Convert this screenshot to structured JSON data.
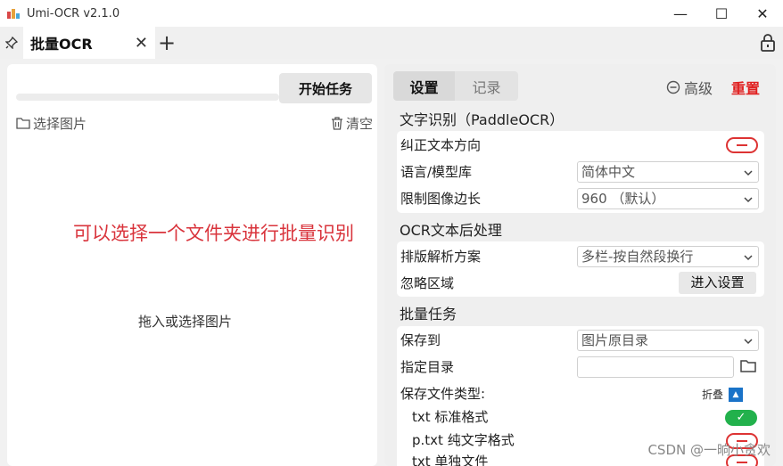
{
  "window": {
    "title": "Umi-OCR v2.1.0",
    "controls": {
      "minimize": "—",
      "maximize": "☐",
      "close": "✕"
    }
  },
  "tabs": {
    "active_tab": "批量OCR",
    "close_glyph": "✕",
    "add_glyph": "+"
  },
  "left_panel": {
    "start_button": "开始任务",
    "select_images": "选择图片",
    "clear": "清空",
    "drop_hint": "拖入或选择图片",
    "progress": 0,
    "annotation": "可以选择一个文件夹进行批量识别"
  },
  "right_panel": {
    "tabs": [
      "设置",
      "记录"
    ],
    "advanced": "高级",
    "reset": "重置",
    "sections": {
      "ocr": {
        "title": "文字识别（PaddleOCR）",
        "rows": {
          "correct_direction": "纠正文本方向",
          "language": "语言/模型库",
          "language_value": "简体中文",
          "limit_size": "限制图像边长",
          "limit_size_value": "960 （默认）"
        }
      },
      "post": {
        "title": "OCR文本后处理",
        "rows": {
          "layout": "排版解析方案",
          "layout_value": "多栏-按自然段换行",
          "ignore_area": "忽略区域",
          "enter_settings": "进入设置"
        }
      },
      "batch": {
        "title": "批量任务",
        "rows": {
          "save_to": "保存到",
          "save_to_value": "图片原目录",
          "target_dir": "指定目录",
          "target_dir_value": "",
          "file_types": "保存文件类型:",
          "collapse": "折叠",
          "txt_standard": "txt 标准格式",
          "ptxt": "p.txt 纯文字格式",
          "txt_single": "txt 单独文件"
        }
      }
    }
  },
  "watermark": "CSDN @一晌小贪欢",
  "colors": {
    "accent_red": "#d9343c",
    "reset_red": "#e02020",
    "toggle_on": "#22b14c",
    "collapse_blue": "#1a73c8"
  }
}
